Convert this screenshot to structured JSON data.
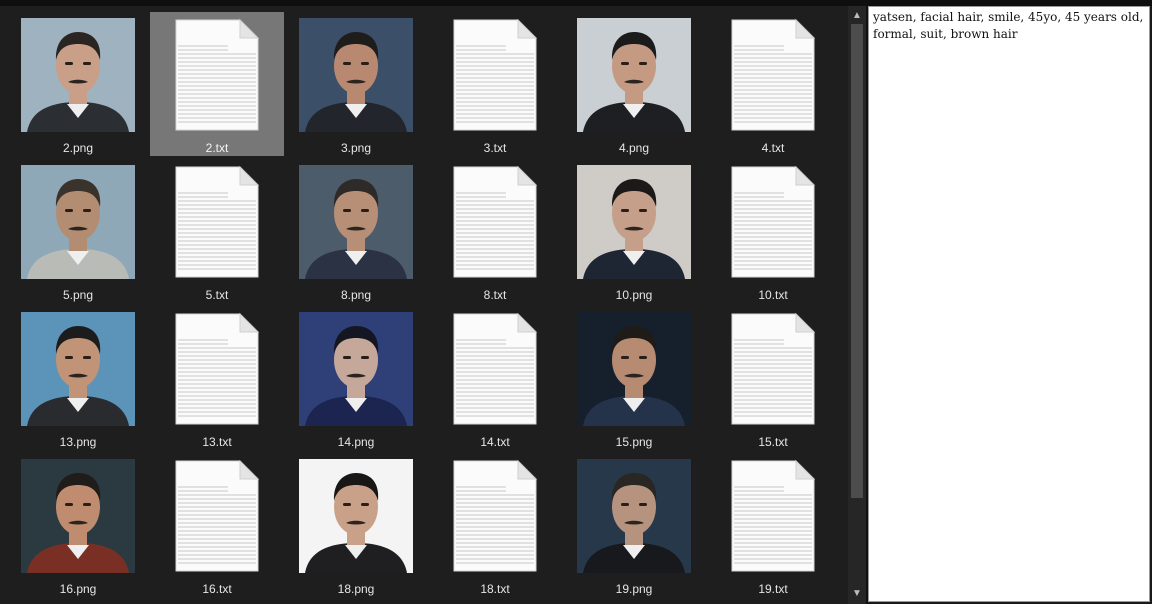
{
  "files": [
    {
      "name": "2.png",
      "kind": "image",
      "bg": "#9fb2c0",
      "skin": "#c9a087",
      "hair": "#2a2522",
      "suit": "#2b2e33"
    },
    {
      "name": "2.txt",
      "kind": "text",
      "selected": true
    },
    {
      "name": "3.png",
      "kind": "image",
      "bg": "#3b5068",
      "skin": "#b98870",
      "hair": "#1e1d1c",
      "suit": "#22262c"
    },
    {
      "name": "3.txt",
      "kind": "text"
    },
    {
      "name": "4.png",
      "kind": "image",
      "bg": "#c9cfd2",
      "skin": "#c49a82",
      "hair": "#1c1b1b",
      "suit": "#1e1f22"
    },
    {
      "name": "4.txt",
      "kind": "text"
    },
    {
      "name": "5.png",
      "kind": "image",
      "bg": "#8fa8b8",
      "skin": "#b38d72",
      "hair": "#3a332c",
      "suit": "#b9bcb6"
    },
    {
      "name": "5.txt",
      "kind": "text"
    },
    {
      "name": "8.png",
      "kind": "image",
      "bg": "#4d5c6a",
      "skin": "#b78f77",
      "hair": "#2e2a28",
      "suit": "#2a3244"
    },
    {
      "name": "8.txt",
      "kind": "text"
    },
    {
      "name": "10.png",
      "kind": "image",
      "bg": "#cfcbc7",
      "skin": "#c69f8a",
      "hair": "#1b1a19",
      "suit": "#1f2633"
    },
    {
      "name": "10.txt",
      "kind": "text"
    },
    {
      "name": "13.png",
      "kind": "image",
      "bg": "#5c93b8",
      "skin": "#c19377",
      "hair": "#1d1c1c",
      "suit": "#2a2b2e"
    },
    {
      "name": "13.txt",
      "kind": "text"
    },
    {
      "name": "14.png",
      "kind": "image",
      "bg": "#2f3f78",
      "skin": "#c6a89a",
      "hair": "#141622",
      "suit": "#1c2550"
    },
    {
      "name": "14.txt",
      "kind": "text"
    },
    {
      "name": "15.png",
      "kind": "image",
      "bg": "#16202c",
      "skin": "#b78b72",
      "hair": "#1e1b19",
      "suit": "#24324a"
    },
    {
      "name": "15.txt",
      "kind": "text"
    },
    {
      "name": "16.png",
      "kind": "image",
      "bg": "#2a3a40",
      "skin": "#c08c70",
      "hair": "#1f1c1a",
      "suit": "#7a2f24"
    },
    {
      "name": "16.txt",
      "kind": "text"
    },
    {
      "name": "18.png",
      "kind": "image",
      "bg": "#f4f4f4",
      "skin": "#c9a088",
      "hair": "#181716",
      "suit": "#1f1f22"
    },
    {
      "name": "18.txt",
      "kind": "text"
    },
    {
      "name": "19.png",
      "kind": "image",
      "bg": "#26384a",
      "skin": "#b6937e",
      "hair": "#2a2624",
      "suit": "#17191d"
    },
    {
      "name": "19.txt",
      "kind": "text"
    }
  ],
  "preview": {
    "text": "yatsen, facial hair, smile, 45yo, 45 years old, formal, suit, brown hair"
  },
  "scrollbar": {
    "up_icon": "▲",
    "down_icon": "▼"
  }
}
